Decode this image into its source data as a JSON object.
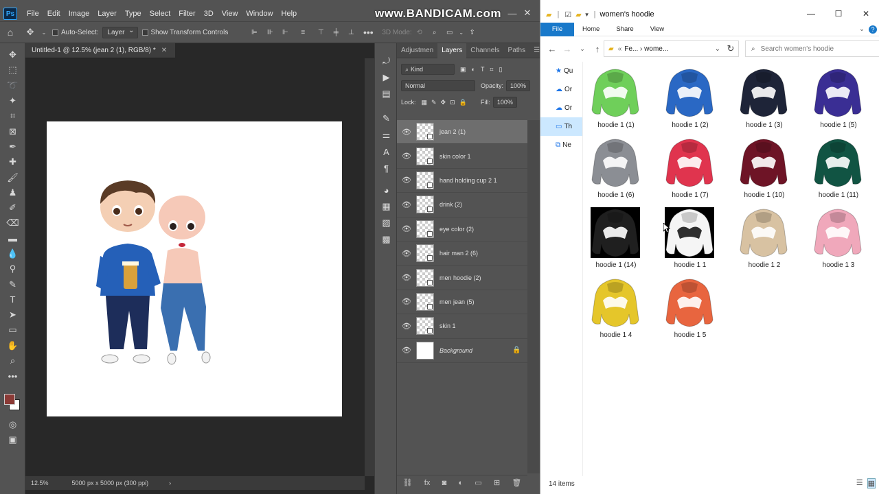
{
  "ps": {
    "menu": [
      "File",
      "Edit",
      "Image",
      "Layer",
      "Type",
      "Select",
      "Filter",
      "3D",
      "View",
      "Window",
      "Help"
    ],
    "watermark": "www.BANDICAM.com",
    "options": {
      "auto_select": "Auto-Select:",
      "layer_dd": "Layer",
      "transform": "Show Transform Controls",
      "mode3d": "3D Mode:"
    },
    "doc_tab": "Untitled-1 @ 12.5% (jean 2 (1), RGB/8) *",
    "zoom": "12.5%",
    "doc_info": "5000 px x 5000 px (300 ppi)",
    "panel_tabs": [
      "Adjustmen",
      "Layers",
      "Channels",
      "Paths"
    ],
    "kind": "Kind",
    "blend": "Normal",
    "opacity_label": "Opacity:",
    "opacity": "100%",
    "lock_label": "Lock:",
    "fill_label": "Fill:",
    "fill": "100%",
    "layers": [
      {
        "name": "jean 2 (1)",
        "selected": true
      },
      {
        "name": "skin color 1"
      },
      {
        "name": "hand holding cup 2 1"
      },
      {
        "name": "drink (2)"
      },
      {
        "name": "eye color (2)"
      },
      {
        "name": "hair man 2 (6)"
      },
      {
        "name": "men hoodie (2)"
      },
      {
        "name": "men jean (5)"
      },
      {
        "name": "skin 1"
      },
      {
        "name": "Background",
        "locked": true
      }
    ],
    "colors": {
      "fg": "#8b3a36",
      "bg": "#ffffff"
    }
  },
  "explorer": {
    "title": "women's hoodie",
    "ribbon": [
      "File",
      "Home",
      "Share",
      "View"
    ],
    "address": "Fe...  ›  wome...",
    "search_placeholder": "Search women's hoodie",
    "nav": [
      {
        "icon": "star-icon",
        "label": "Qu"
      },
      {
        "icon": "cloud-icon",
        "label": "Or"
      },
      {
        "icon": "cloud-icon",
        "label": "Or"
      },
      {
        "icon": "pc-icon",
        "label": "Th"
      },
      {
        "icon": "network-icon",
        "label": "Ne"
      }
    ],
    "items": [
      {
        "name": "hoodie 1 (1)",
        "color": "#6fcf5a"
      },
      {
        "name": "hoodie 1 (2)",
        "color": "#2a68c4"
      },
      {
        "name": "hoodie 1 (3)",
        "color": "#1e2438"
      },
      {
        "name": "hoodie 1 (5)",
        "color": "#3a2e94"
      },
      {
        "name": "hoodie 1 (6)",
        "color": "#8b8e94"
      },
      {
        "name": "hoodie 1 (7)",
        "color": "#e0344e"
      },
      {
        "name": "hoodie 1 (10)",
        "color": "#6e1426"
      },
      {
        "name": "hoodie 1 (11)",
        "color": "#115443"
      },
      {
        "name": "hoodie 1 (14)",
        "color": "#1f1f1f"
      },
      {
        "name": "hoodie 1 1",
        "color": "#f5f5f5"
      },
      {
        "name": "hoodie 1 2",
        "color": "#d8c2a2"
      },
      {
        "name": "hoodie 1 3",
        "color": "#f0a8bb"
      },
      {
        "name": "hoodie 1 4",
        "color": "#e5c62a"
      },
      {
        "name": "hoodie 1 5",
        "color": "#e8653f"
      }
    ],
    "status": "14 items"
  }
}
